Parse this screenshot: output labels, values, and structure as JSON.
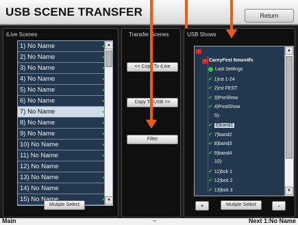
{
  "header": {
    "title": "USB SCENE TRANSFER",
    "return_label": "Return"
  },
  "ilive": {
    "title": "iLive Scenes",
    "rows": [
      {
        "label": "1) No Name",
        "checked": true
      },
      {
        "label": "2) No Name",
        "checked": true
      },
      {
        "label": "3) No Name",
        "checked": true
      },
      {
        "label": "4) No Name",
        "checked": true
      },
      {
        "label": "5) No Name",
        "checked": true
      },
      {
        "label": "6) No Name",
        "checked": true
      },
      {
        "label": "7) No Name",
        "checked": true,
        "selected": true
      },
      {
        "label": "8) No Name",
        "checked": true
      },
      {
        "label": "9) No Name",
        "checked": true
      },
      {
        "label": "10) No Name",
        "checked": true
      },
      {
        "label": "11) No Name",
        "checked": true
      },
      {
        "label": "12) No Name",
        "checked": false
      },
      {
        "label": "13) No Name",
        "checked": true
      },
      {
        "label": "14) No Name",
        "checked": false
      },
      {
        "label": "15) No Name",
        "checked": true
      }
    ],
    "select_label": "Mutiple Select"
  },
  "transfer": {
    "title": "Transfer Scenes",
    "copy_to_ilive": "<< Copy To iLive",
    "copy_to_usb": "Copy To USB >>",
    "filter": "Filter"
  },
  "usb": {
    "title": "USB Shows",
    "tree": [
      {
        "label": "",
        "type": "usb",
        "indent": 0
      },
      {
        "label": "CareyFest 6mon4fx",
        "type": "show",
        "indent": 1
      },
      {
        "label": "Last Settings",
        "type": "dot",
        "indent": 2
      },
      {
        "label": "1)rst 1-24",
        "type": "check",
        "indent": 2
      },
      {
        "label": "2)rst FEST",
        "type": "check",
        "indent": 2
      },
      {
        "label": "3)PreShow",
        "type": "check",
        "indent": 2
      },
      {
        "label": "4)PostShow",
        "type": "check",
        "indent": 2
      },
      {
        "label": "5)-",
        "type": "none",
        "indent": 3
      },
      {
        "label": "6)band1",
        "type": "check",
        "indent": 2,
        "selected": true
      },
      {
        "label": "7)band2",
        "type": "check",
        "indent": 2
      },
      {
        "label": "8)band3",
        "type": "check",
        "indent": 2
      },
      {
        "label": "9)band4",
        "type": "check",
        "indent": 2
      },
      {
        "label": "10)-",
        "type": "none",
        "indent": 3
      },
      {
        "label": "11)bck 1",
        "type": "check",
        "indent": 2
      },
      {
        "label": "12)bck 2",
        "type": "check",
        "indent": 2
      },
      {
        "label": "13)bck 3",
        "type": "check",
        "indent": 2
      }
    ],
    "plus_label": "+",
    "select_label": "Mutiple Select",
    "minus_label": "-"
  },
  "footer": {
    "left": "Main",
    "icon": "⇔",
    "right": "Next 1:No Name"
  },
  "colors": {
    "accent": "#f25a0c",
    "check": "#28c83a",
    "list_bg": "#23374e"
  }
}
